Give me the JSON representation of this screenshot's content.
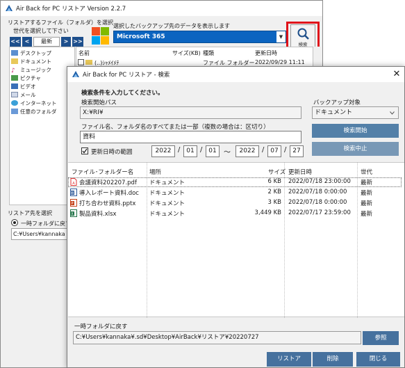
{
  "main_window": {
    "title": "Air Back for PC リストア  Version 2.2.7",
    "list_label": "リストアするファイル（フォルダ）を選択",
    "generation_label": "世代を選択して下さい",
    "generation_nav": [
      "<<",
      "<",
      "最新",
      ">",
      ">>"
    ],
    "backup_display_label": "選択したバックアップ先のデータを表示します",
    "backup_selected": "Microsoft 365",
    "search_button_label": "検索",
    "tree_items": [
      "デスクトップ",
      "ドキュメント",
      "ミュージック",
      "ピクチャ",
      "ビデオ",
      "メール",
      "インターネット",
      "任意のフォルダ"
    ],
    "file_list": {
      "headers": {
        "name": "名前",
        "size": "サイズ(KB)",
        "type": "種類",
        "updated": "更新日時"
      },
      "row": {
        "name": "(..)ｼｬﾒｲﾒﾃ",
        "type": "ファイル フォルダー",
        "updated": "2022/09/29 11:11"
      }
    },
    "restore_dest_label": "リストア先を選択",
    "restore_dest_option": "一時フォルダに戻す",
    "restore_path": "C:¥Users¥kannaka"
  },
  "dialog": {
    "title": "Air Back for PC リストア - 検索",
    "close": "✕",
    "instruction": "検索条件を入力してください。",
    "start_path_label": "検索開始パス",
    "start_path": "X:¥RI¥",
    "backup_target_label": "バックアップ対象",
    "backup_target": "ドキュメント",
    "name_label": "ファイル名、フォルダ名のすべてまたは一部（複数の場合は：区切り）",
    "name_value": "資料",
    "date_range_label": "更新日時の範囲",
    "date_from": {
      "y": "2022",
      "m": "01",
      "d": "01"
    },
    "date_to": {
      "y": "2022",
      "m": "07",
      "d": "27"
    },
    "date_sep": "/",
    "range_sep": "～",
    "search_start": "検索開始",
    "search_stop": "検索中止",
    "results": {
      "headers": {
        "name": "ファイル･フォルダー名",
        "location": "場所",
        "size": "サイズ",
        "updated": "更新日時",
        "generation": "世代"
      },
      "rows": [
        {
          "icon": "pdf-icon",
          "name": "会議資料202207.pdf",
          "location": "ドキュメント",
          "size": "6 KB",
          "updated": "2022/07/18 23:00:00",
          "generation": "最新"
        },
        {
          "icon": "word-icon",
          "name": "導入レポート資料.doc",
          "location": "ドキュメント",
          "size": "2 KB",
          "updated": "2022/07/18 0:00:00",
          "generation": "最新"
        },
        {
          "icon": "ppt-icon",
          "name": "打ち合わせ資料.pptx",
          "location": "ドキュメント",
          "size": "3 KB",
          "updated": "2022/07/18 0:00:00",
          "generation": "最新"
        },
        {
          "icon": "excel-icon",
          "name": "製品資料.xlsx",
          "location": "ドキュメント",
          "size": "3,449 KB",
          "updated": "2022/07/17 23:59:00",
          "generation": "最新"
        }
      ]
    },
    "restore_folder_label": "一時フォルダに戻す",
    "restore_folder_path": "C:¥Users¥kannaka¥.sd¥Desktop¥AirBack¥リストア¥20220727",
    "browse": "参照",
    "restore": "リストア",
    "delete": "削除",
    "close_button": "閉じる"
  },
  "colors": {
    "accent": "#0b64c0",
    "highlight": "#e0121a",
    "button": "#5380a8"
  }
}
